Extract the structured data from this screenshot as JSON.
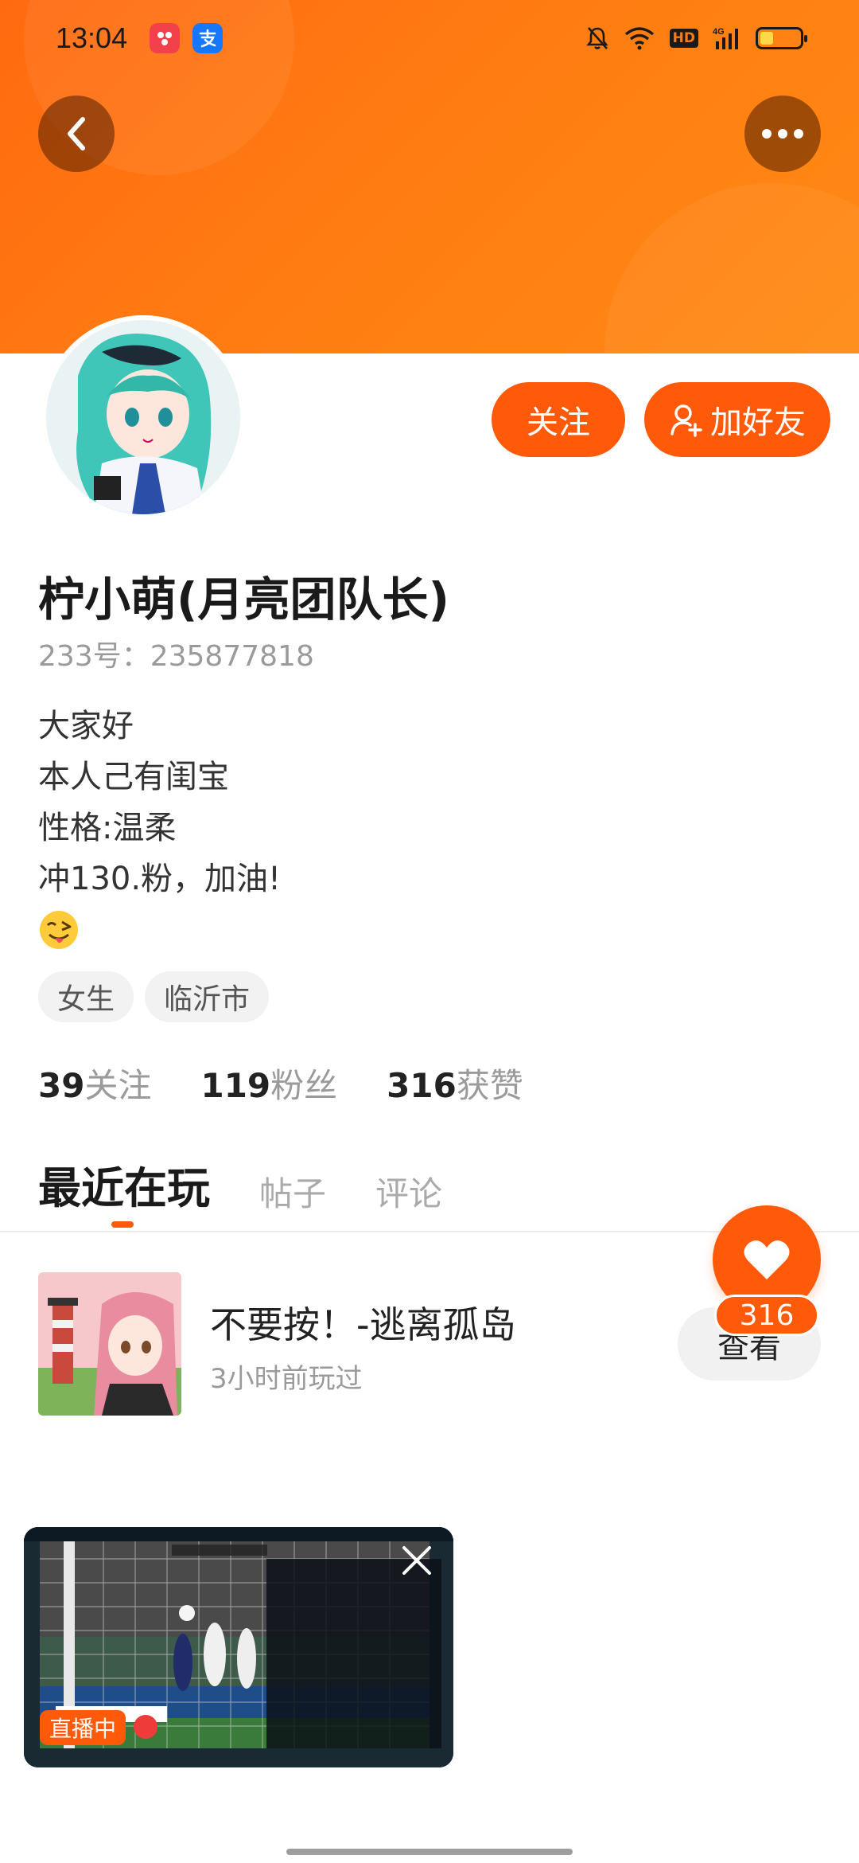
{
  "status_bar": {
    "time": "13:04",
    "app_icons": [
      "app-red-icon",
      "alipay-icon"
    ],
    "network": "4G",
    "hd": "HD"
  },
  "header": {
    "back_icon": "chevron-left-icon",
    "more_icon": "more-horizontal-icon"
  },
  "actions": {
    "follow_label": "关注",
    "add_friend_label": "加好友"
  },
  "profile": {
    "name": "柠小萌(月亮团队长)",
    "uid": "233号：235877818",
    "bio": [
      "大家好",
      "本人己有闺宝",
      "性格:温柔",
      "冲130.粉，加油!"
    ],
    "bio_emoji": "tongue-wink-emoji",
    "tags": [
      "女生",
      "临沂市"
    ]
  },
  "stats": [
    {
      "num": "39",
      "label": "关注"
    },
    {
      "num": "119",
      "label": "粉丝"
    },
    {
      "num": "316",
      "label": "获赞"
    }
  ],
  "tabs": [
    {
      "label": "最近在玩",
      "active": true
    },
    {
      "label": "帖子",
      "active": false
    },
    {
      "label": "评论",
      "active": false
    }
  ],
  "recent_game": {
    "title": "不要按！-逃离孤岛",
    "subtitle": "3小时前玩过",
    "button_label": "查看"
  },
  "like_fab": {
    "count": "316"
  },
  "video_float": {
    "live_label": "直播中"
  },
  "colors": {
    "accent": "#ff5a0a",
    "banner": "#ff7a12"
  }
}
